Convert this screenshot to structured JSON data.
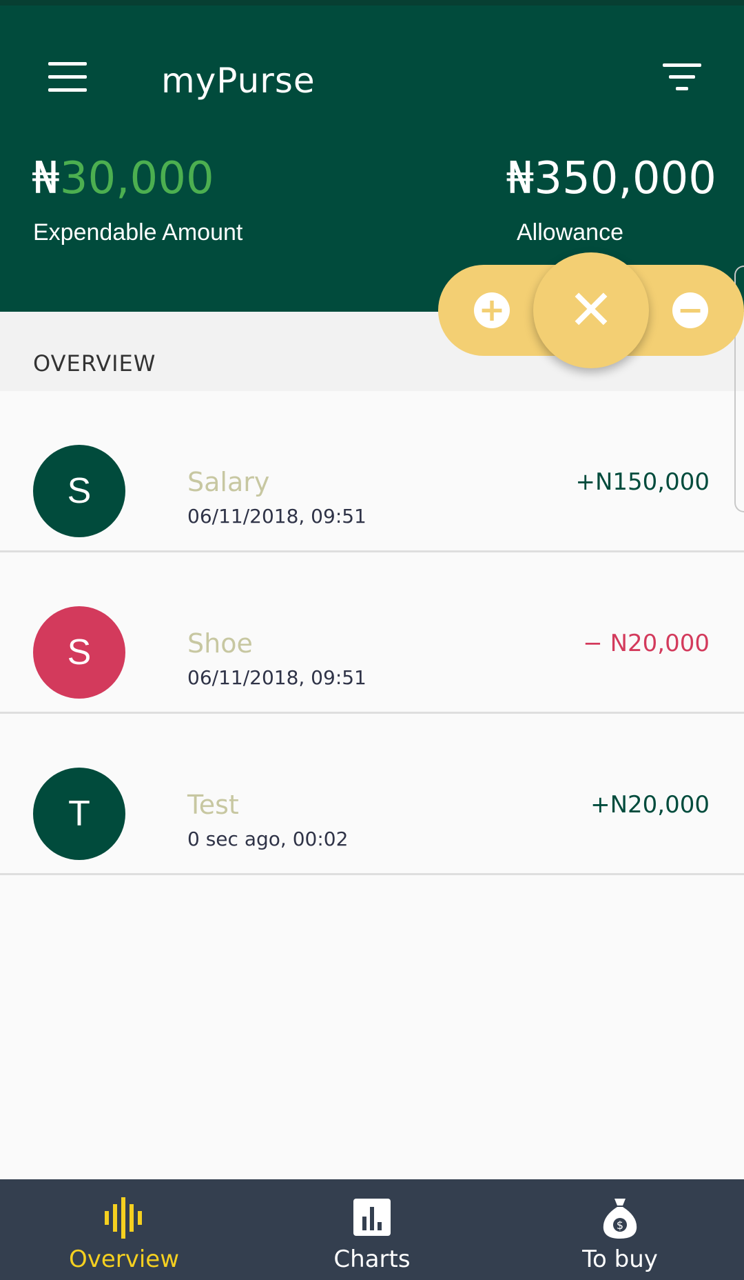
{
  "app": {
    "title": "myPurse"
  },
  "summary": {
    "expendable_currency": "₦",
    "expendable_value": "30,000",
    "expendable_label": "Expendable Amount",
    "allowance_amount": "₦350,000",
    "allowance_label": "Allowance"
  },
  "section": {
    "title": "OVERVIEW"
  },
  "fab": {
    "add_icon": "+",
    "close_icon": "✕",
    "subtract_icon": "−"
  },
  "transactions": [
    {
      "initial": "S",
      "name": "Salary",
      "date": "06/11/2018, 09:51",
      "amount": "+N150,000",
      "avatar_color": "#014b3c",
      "amount_color": "#014b3c"
    },
    {
      "initial": "S",
      "name": "Shoe",
      "date": "06/11/2018, 09:51",
      "amount": "− N20,000",
      "avatar_color": "#d33a5c",
      "amount_color": "#d33a5c"
    },
    {
      "initial": "T",
      "name": "Test",
      "date": "0 sec ago, 00:02",
      "amount": "+N20,000",
      "avatar_color": "#014b3c",
      "amount_color": "#014b3c"
    }
  ],
  "nav": {
    "items": [
      {
        "label": "Overview",
        "icon": "equalizer-icon",
        "active": true
      },
      {
        "label": "Charts",
        "icon": "bar-chart-icon",
        "active": false
      },
      {
        "label": "To buy",
        "icon": "money-bag-icon",
        "active": false
      }
    ]
  },
  "colors": {
    "primary": "#014b3c",
    "accent": "#f3cf73",
    "positive_amount": "#4caf50",
    "negative": "#d33a5c",
    "nav_background": "#343f4f",
    "nav_active": "#f5d020"
  }
}
